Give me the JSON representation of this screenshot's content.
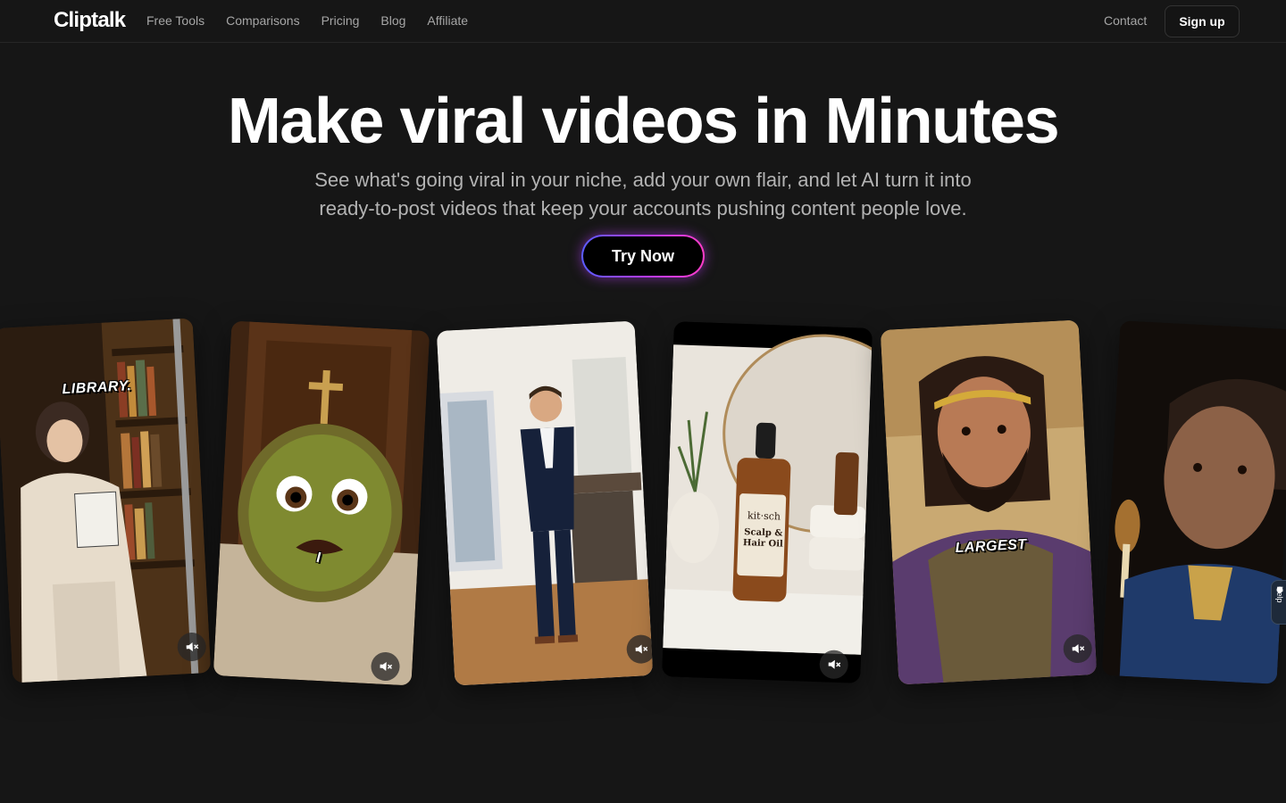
{
  "nav": {
    "logo": "Cliptalk",
    "links": [
      "Free Tools",
      "Comparisons",
      "Pricing",
      "Blog",
      "Affiliate"
    ],
    "contact": "Contact",
    "signup": "Sign up"
  },
  "hero": {
    "title": "Make viral videos in Minutes",
    "subtitle": "See what's going viral in your niche, add your own flair, and let AI turn it into ready-to-post videos that keep your accounts pushing content people love.",
    "cta": "Try Now"
  },
  "cards": [
    {
      "caption": "LIBRARY."
    },
    {
      "caption": "I"
    },
    {
      "caption": ""
    },
    {
      "label_brand": "kit·sch",
      "label_product": "Scalp & Hair Oil"
    },
    {
      "caption": "LARGEST"
    },
    {
      "caption": ""
    }
  ],
  "help": {
    "label": "Help"
  },
  "icons": {
    "mute": "speaker-muted-icon",
    "help": "chat-bubble-icon"
  }
}
